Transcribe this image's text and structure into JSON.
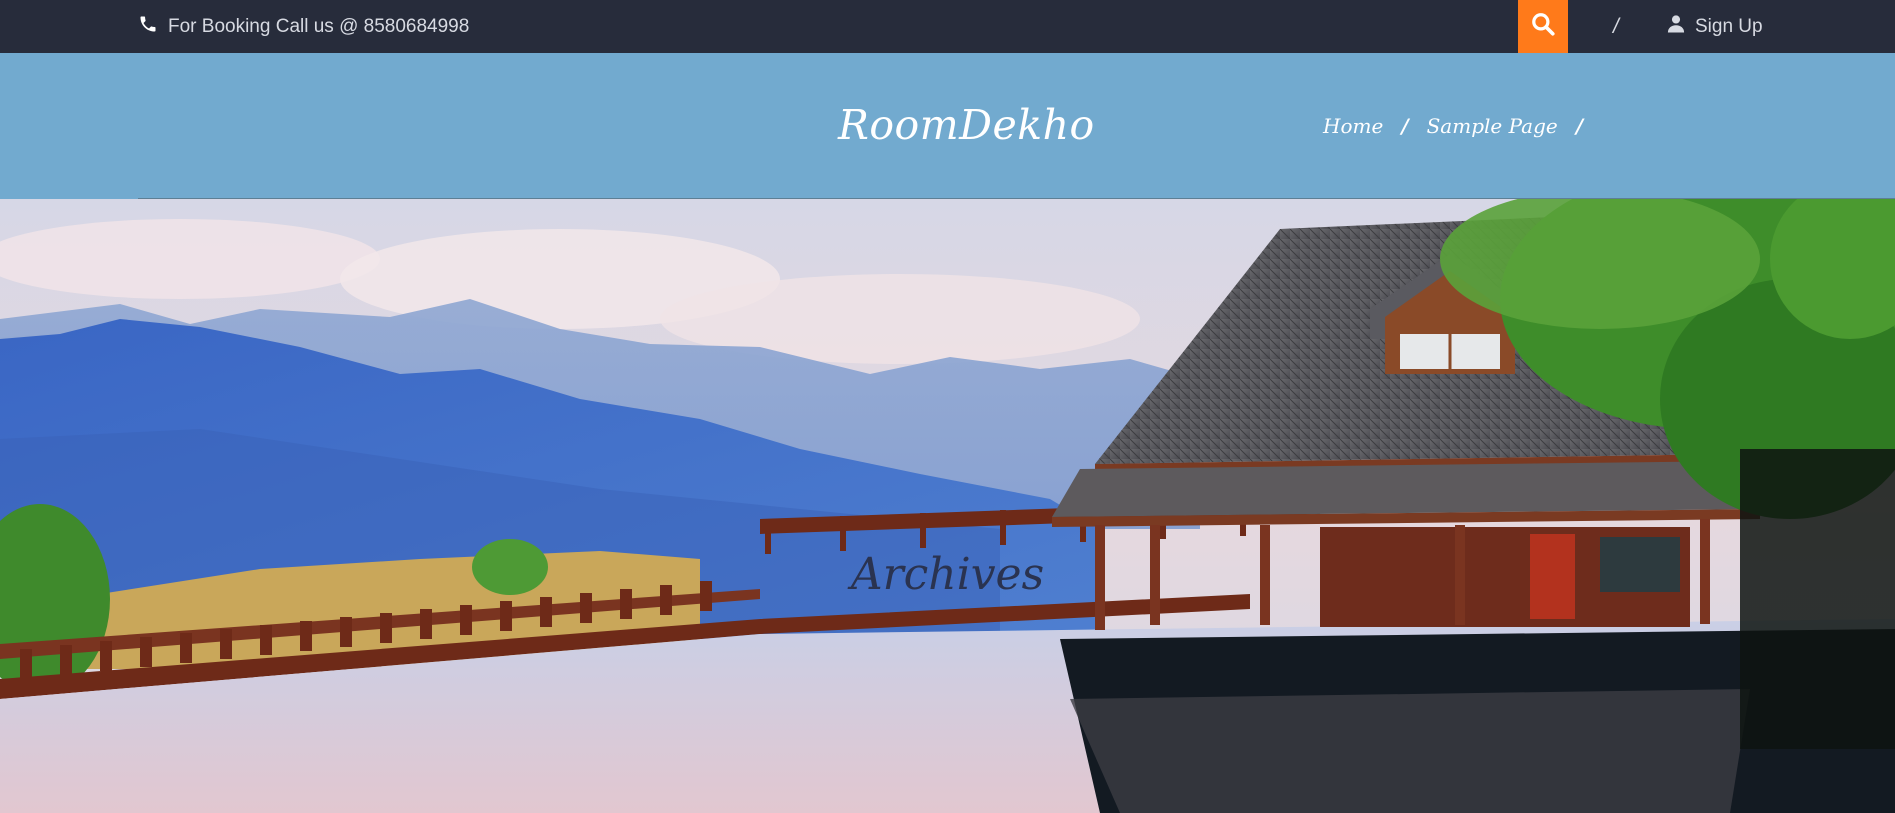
{
  "topbar": {
    "booking_text": "For Booking Call us @ 8580684998",
    "phone_icon": "phone-icon",
    "search_icon": "search-icon",
    "separator": "/",
    "signup_label": "Sign Up",
    "user_icon": "user-icon",
    "search_bg": "#ff7a1a",
    "bar_bg": "#272c3b"
  },
  "header": {
    "brand": "RoomDekho",
    "bg": "#72aacf",
    "nav": [
      {
        "label": "Home"
      },
      {
        "label": "Sample Page"
      }
    ],
    "nav_separator": "/"
  },
  "hero": {
    "title": "Archives"
  }
}
